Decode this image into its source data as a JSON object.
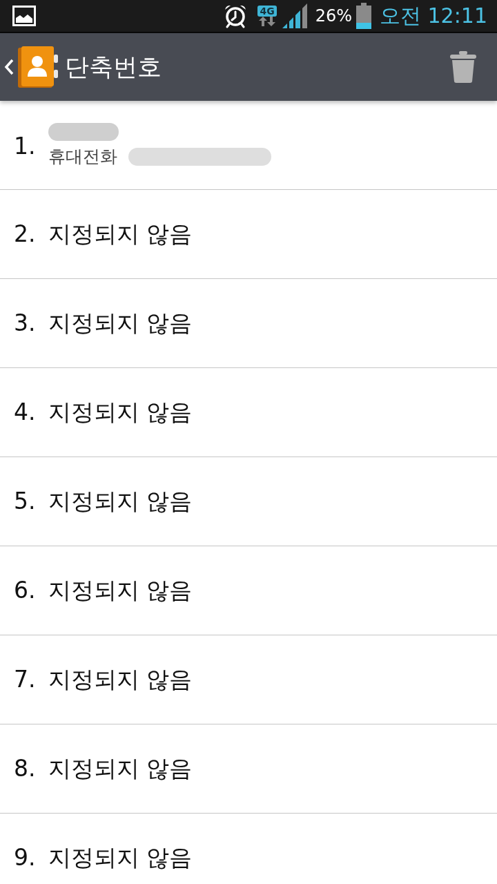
{
  "status_bar": {
    "network": "4G",
    "battery": "26%",
    "time": "오전 12:11"
  },
  "header": {
    "title": "단축번호"
  },
  "speed_dials": [
    {
      "kind": "contact",
      "number": "1.",
      "phone_label": "휴대전화"
    },
    {
      "kind": "empty",
      "number": "2.",
      "label": "지정되지 않음"
    },
    {
      "kind": "empty",
      "number": "3.",
      "label": "지정되지 않음"
    },
    {
      "kind": "empty",
      "number": "4.",
      "label": "지정되지 않음"
    },
    {
      "kind": "empty",
      "number": "5.",
      "label": "지정되지 않음"
    },
    {
      "kind": "empty",
      "number": "6.",
      "label": "지정되지 않음"
    },
    {
      "kind": "empty",
      "number": "7.",
      "label": "지정되지 않음"
    },
    {
      "kind": "empty",
      "number": "8.",
      "label": "지정되지 않음"
    },
    {
      "kind": "empty",
      "number": "9.",
      "label": "지정되지 않음"
    }
  ]
}
